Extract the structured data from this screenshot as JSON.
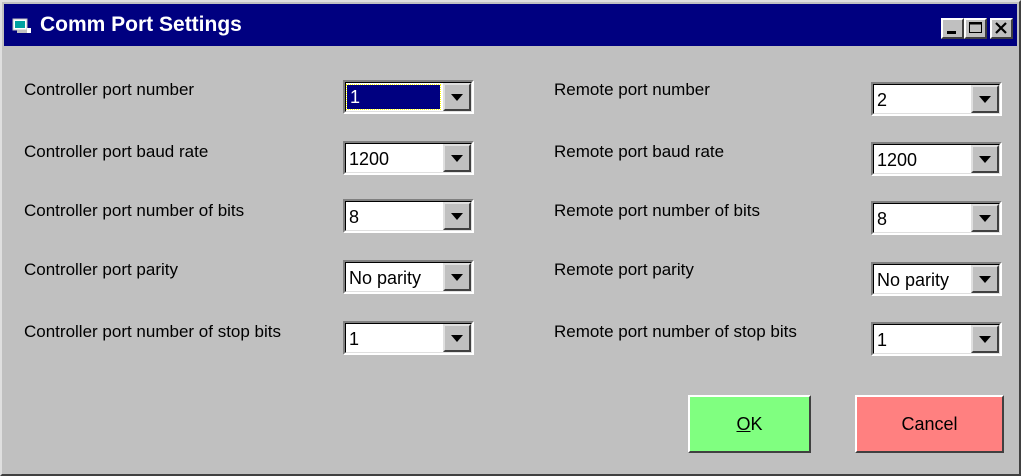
{
  "window": {
    "title": "Comm Port Settings",
    "icon": "app-icon",
    "controls": [
      "minimize-icon",
      "maximize-icon",
      "close-icon"
    ]
  },
  "controller": {
    "port_number": {
      "label": "Controller port number",
      "value": "1"
    },
    "baud_rate": {
      "label": "Controller port baud rate",
      "value": "1200"
    },
    "bits": {
      "label": "Controller port number of bits",
      "value": "8"
    },
    "parity": {
      "label": "Controller port parity",
      "value": "No parity"
    },
    "stop_bits": {
      "label": "Controller port number of stop bits",
      "value": "1"
    }
  },
  "remote": {
    "port_number": {
      "label": "Remote port number",
      "value": "2"
    },
    "baud_rate": {
      "label": "Remote port baud rate",
      "value": "1200"
    },
    "bits": {
      "label": "Remote port number of bits",
      "value": "8"
    },
    "parity": {
      "label": "Remote port parity",
      "value": "No parity"
    },
    "stop_bits": {
      "label": "Remote port number of stop bits",
      "value": "1"
    }
  },
  "buttons": {
    "ok": {
      "mnemonic": "O",
      "rest": "K",
      "color": "#80ff80"
    },
    "cancel": {
      "label": "Cancel",
      "color": "#ff8080"
    }
  },
  "colors": {
    "titlebar": "#000080",
    "face": "#c0c0c0"
  }
}
